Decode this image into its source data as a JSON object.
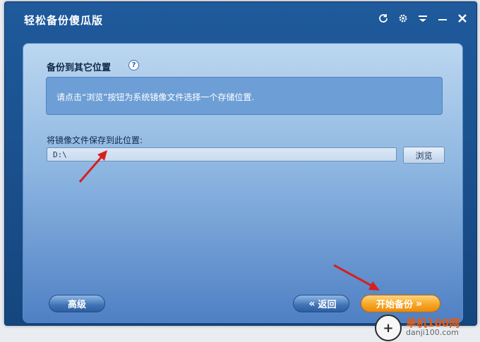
{
  "window": {
    "title": "轻松备份傻瓜版"
  },
  "titlebar": {
    "icons": [
      {
        "name": "refresh-icon",
        "glyph": "⟳"
      },
      {
        "name": "gear-icon",
        "glyph": "⚙"
      },
      {
        "name": "menu-icon",
        "glyph": "≡"
      },
      {
        "name": "minimize-icon",
        "glyph": "—"
      },
      {
        "name": "close-icon",
        "glyph": "✕"
      }
    ]
  },
  "section": {
    "title": "备份到其它位置",
    "help_glyph": "?"
  },
  "info": {
    "text": "请点击“浏览”按钮为系统镜像文件选择一个存储位置."
  },
  "path": {
    "label": "将镜像文件保存到此位置:",
    "value": "D:\\"
  },
  "buttons": {
    "browse": "浏览",
    "advanced": "高级",
    "back": "返回",
    "start": "开始备份",
    "back_chevron": "«",
    "start_chevron": "»"
  },
  "colors": {
    "title_bar": "#1f5a9c",
    "accent_orange": "#f6a623",
    "arrow_red": "#d71f1f"
  },
  "watermark": {
    "cn": "单机100网",
    "en": "danji100.com"
  }
}
